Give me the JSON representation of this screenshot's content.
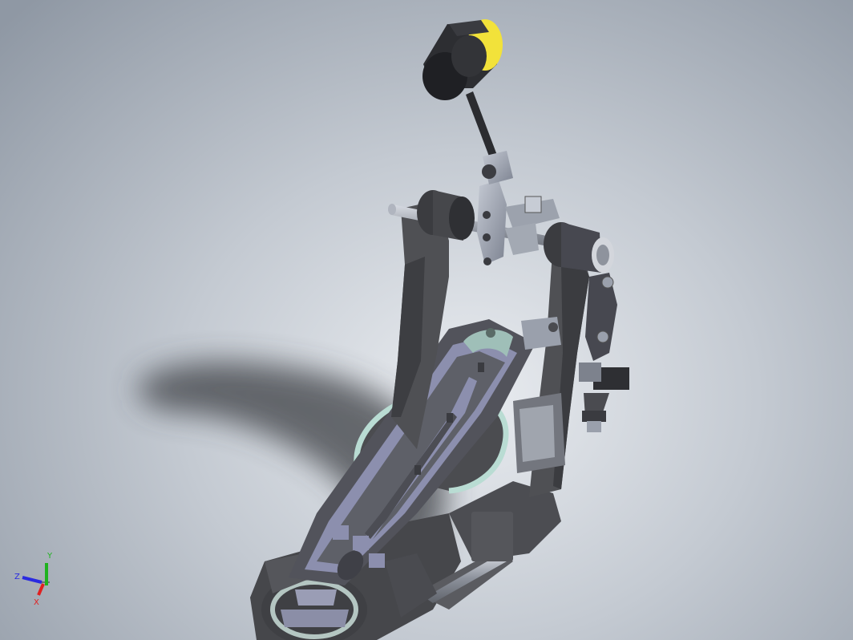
{
  "triad": {
    "x_label": "X",
    "y_label": "Y",
    "z_label": "Z",
    "x_color": "#e02020",
    "y_color": "#1fb21f",
    "z_color": "#2a2ae0"
  },
  "colors": {
    "frame": "#4f5054",
    "frame_dark": "#3a3b3e",
    "metal": "#9aa0ac",
    "beater_felt": "#f2e23a",
    "cam_green": "#b9dcd3"
  }
}
